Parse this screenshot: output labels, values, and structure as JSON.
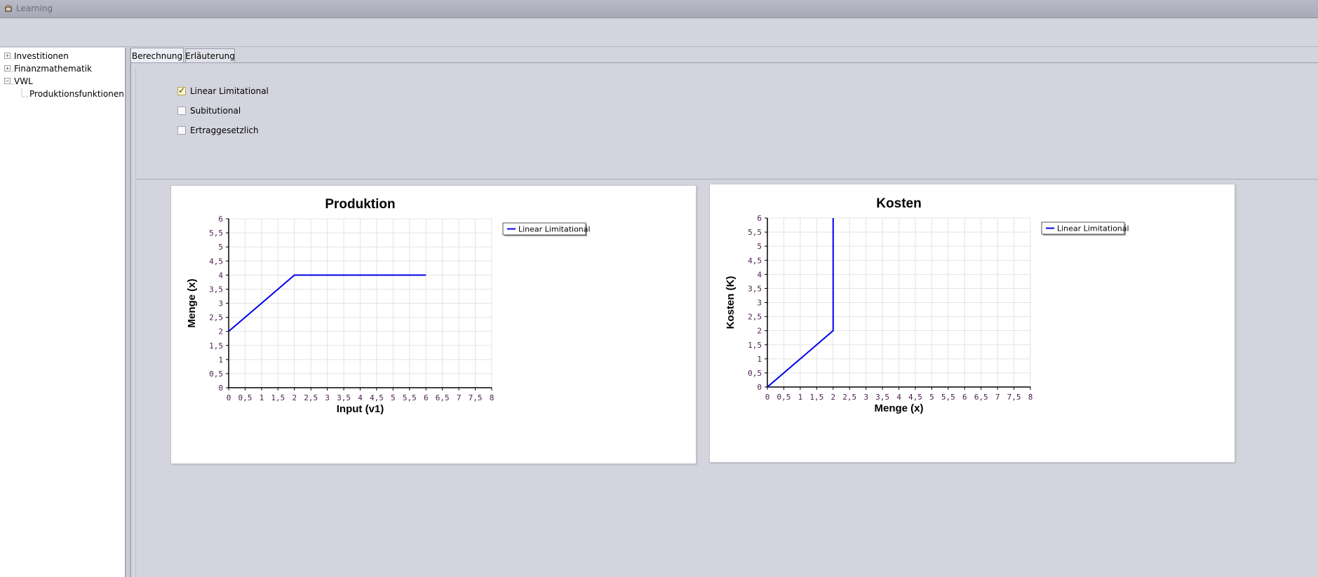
{
  "window": {
    "title": "Learning"
  },
  "tree": {
    "items": [
      {
        "label": "Investitionen",
        "toggle": "+"
      },
      {
        "label": "Finanzmathematik",
        "toggle": "+"
      },
      {
        "label": "VWL",
        "toggle": "−"
      },
      {
        "label": "Produktionsfunktionen",
        "toggle": ""
      }
    ]
  },
  "tabs": [
    {
      "label": "Berechnung",
      "active": true
    },
    {
      "label": "Erläuterung",
      "active": false
    }
  ],
  "options": [
    {
      "label": "Linear Limitational",
      "checked": true
    },
    {
      "label": "Subitutional",
      "checked": false
    },
    {
      "label": "Ertraggesetzlich",
      "checked": false
    }
  ],
  "colors": {
    "series": "#0000ee",
    "background": "#d3d4de"
  },
  "chart_data": [
    {
      "type": "line",
      "title": "Produktion",
      "xlabel": "Input (v1)",
      "ylabel": "Menge (x)",
      "xlim": [
        0,
        8
      ],
      "ylim": [
        0,
        6
      ],
      "xticks": [
        "0",
        "0,5",
        "1",
        "1,5",
        "2",
        "2,5",
        "3",
        "3,5",
        "4",
        "4,5",
        "5",
        "5,5",
        "6",
        "6,5",
        "7",
        "7,5",
        "8"
      ],
      "yticks": [
        "0",
        "0,5",
        "1",
        "1,5",
        "2",
        "2,5",
        "3",
        "3,5",
        "4",
        "4,5",
        "5",
        "5,5",
        "6"
      ],
      "grid": true,
      "legend": "top-right",
      "series": [
        {
          "name": "Linear Limitational",
          "x": [
            0,
            2,
            6
          ],
          "y": [
            2,
            4,
            4
          ]
        }
      ]
    },
    {
      "type": "line",
      "title": "Kosten",
      "xlabel": "Menge (x)",
      "ylabel": "Kosten (K)",
      "xlim": [
        0,
        8
      ],
      "ylim": [
        0,
        6
      ],
      "xticks": [
        "0",
        "0,5",
        "1",
        "1,5",
        "2",
        "2,5",
        "3",
        "3,5",
        "4",
        "4,5",
        "5",
        "5,5",
        "6",
        "6,5",
        "7",
        "7,5",
        "8"
      ],
      "yticks": [
        "0",
        "0,5",
        "1",
        "1,5",
        "2",
        "2,5",
        "3",
        "3,5",
        "4",
        "4,5",
        "5",
        "5,5",
        "6"
      ],
      "grid": true,
      "legend": "top-right",
      "series": [
        {
          "name": "Linear Limitational",
          "x": [
            0,
            2,
            2
          ],
          "y": [
            0,
            2,
            6
          ]
        }
      ]
    }
  ]
}
